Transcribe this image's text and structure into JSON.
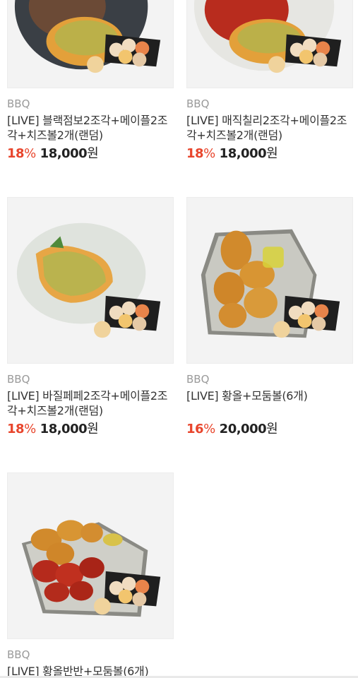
{
  "products": [
    {
      "brand": "BBQ",
      "title_line1": "[LIVE] 블랙점보2조각+메이플2조",
      "title_line2": "각+치즈볼2개(랜덤)",
      "discount": "18",
      "discount_unit": "%",
      "price": "18,000",
      "currency": "원",
      "image_icon": "black-jumbo-chicken-plate"
    },
    {
      "brand": "BBQ",
      "title_line1": "[LIVE] 매직칠리2조각+메이플2조",
      "title_line2": "각+치즈볼2개(랜덤)",
      "discount": "18",
      "discount_unit": "%",
      "price": "18,000",
      "currency": "원",
      "image_icon": "magic-chili-chicken-plate"
    },
    {
      "brand": "BBQ",
      "title_line1": "[LIVE] 바질페페2조각+메이플2조",
      "title_line2": "각+치즈볼2개(랜덤)",
      "discount": "18",
      "discount_unit": "%",
      "price": "18,000",
      "currency": "원",
      "image_icon": "basil-pepe-chicken-plate"
    },
    {
      "brand": "BBQ",
      "title_line1": "[LIVE] 황올+모둠볼(6개)",
      "title_line2": "",
      "discount": "16",
      "discount_unit": "%",
      "price": "20,000",
      "currency": "원",
      "image_icon": "golden-olive-chicken-tray"
    },
    {
      "brand": "BBQ",
      "title_line1": "[LIVE] 황올반반+모둠볼(6개)",
      "title_line2": "",
      "discount": "",
      "discount_unit": "",
      "price": "",
      "currency": "",
      "image_icon": "half-half-chicken-tray"
    }
  ],
  "colors": {
    "discount": "#e8452c",
    "brand": "#9a9a9a",
    "thumb_bg": "#f3f3f3"
  }
}
